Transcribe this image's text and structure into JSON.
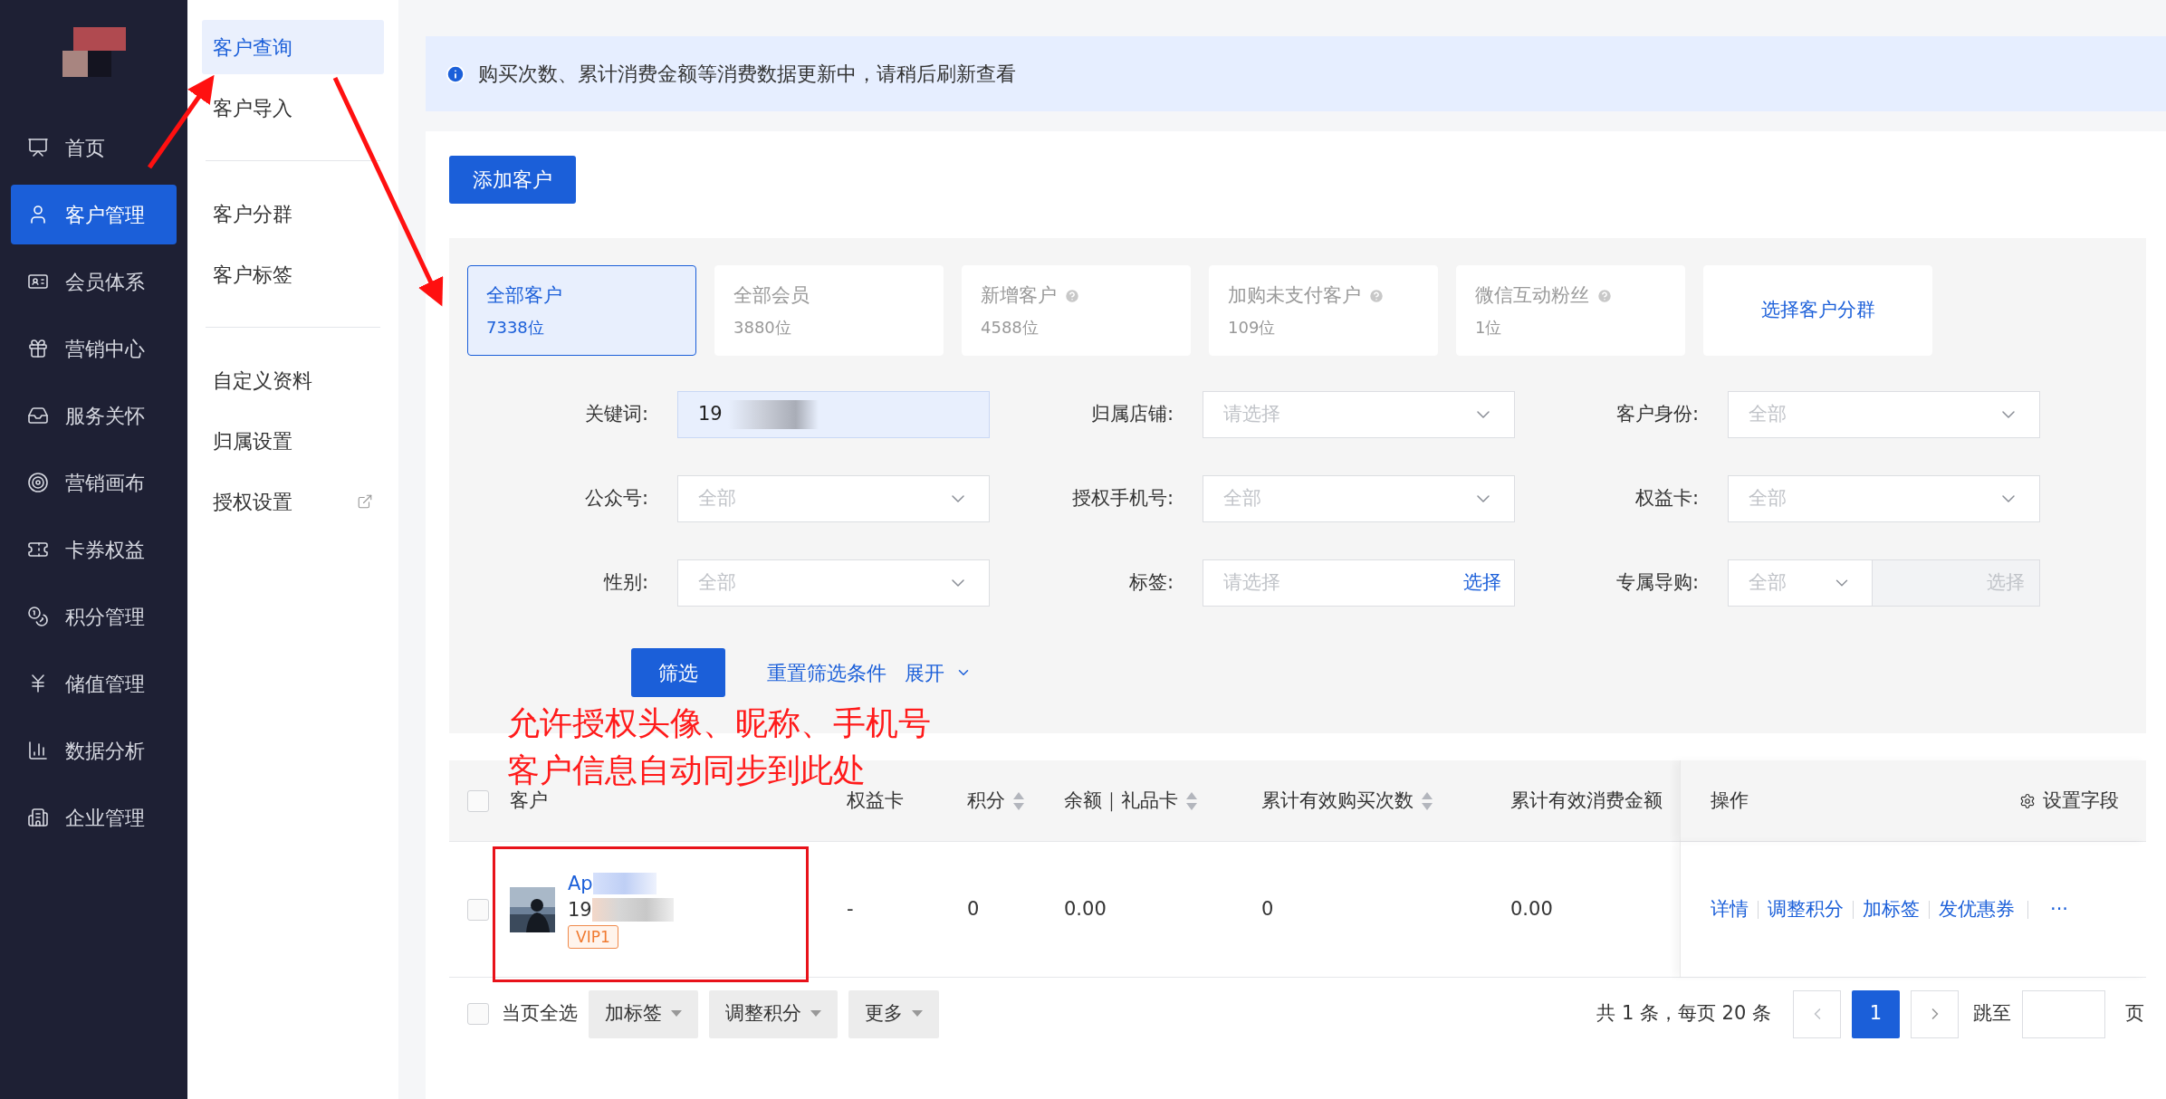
{
  "sidebar": {
    "items": [
      {
        "label": "首页",
        "selected": false
      },
      {
        "label": "客户管理",
        "selected": true
      },
      {
        "label": "会员体系",
        "selected": false
      },
      {
        "label": "营销中心",
        "selected": false
      },
      {
        "label": "服务关怀",
        "selected": false
      },
      {
        "label": "营销画布",
        "selected": false
      },
      {
        "label": "卡券权益",
        "selected": false
      },
      {
        "label": "积分管理",
        "selected": false
      },
      {
        "label": "储值管理",
        "selected": false
      },
      {
        "label": "数据分析",
        "selected": false
      },
      {
        "label": "企业管理",
        "selected": false
      }
    ]
  },
  "subnav": {
    "groups": [
      [
        {
          "label": "客户查询",
          "selected": true,
          "external": false
        },
        {
          "label": "客户导入",
          "selected": false,
          "external": false
        }
      ],
      [
        {
          "label": "客户分群",
          "selected": false,
          "external": false
        },
        {
          "label": "客户标签",
          "selected": false,
          "external": false
        }
      ],
      [
        {
          "label": "自定义资料",
          "selected": false,
          "external": false
        },
        {
          "label": "归属设置",
          "selected": false,
          "external": false
        },
        {
          "label": "授权设置",
          "selected": false,
          "external": true
        }
      ]
    ]
  },
  "notice": {
    "text": "购买次数、累计消费金额等消费数据更新中，请稍后刷新查看"
  },
  "add_button": "添加客户",
  "segments": [
    {
      "kind": "stat",
      "label": "全部客户",
      "count": "7338位",
      "help": false,
      "selected": true
    },
    {
      "kind": "stat",
      "label": "全部会员",
      "count": "3880位",
      "help": false,
      "selected": false
    },
    {
      "kind": "stat",
      "label": "新增客户",
      "count": "4588位",
      "help": true,
      "selected": false
    },
    {
      "kind": "stat",
      "label": "加购未支付客户",
      "count": "109位",
      "help": true,
      "selected": false
    },
    {
      "kind": "stat",
      "label": "微信互动粉丝",
      "count": "1位",
      "help": true,
      "selected": false
    },
    {
      "kind": "link",
      "label": "选择客户分群",
      "selected": false
    }
  ],
  "filters": [
    {
      "kind": "text",
      "label": "关键词:",
      "value": "19"
    },
    {
      "kind": "select",
      "label": "归属店铺:",
      "placeholder": "请选择"
    },
    {
      "kind": "select",
      "label": "客户身份:",
      "placeholder": "全部"
    },
    {
      "kind": "select",
      "label": "公众号:",
      "placeholder": "全部"
    },
    {
      "kind": "select",
      "label": "授权手机号:",
      "placeholder": "全部"
    },
    {
      "kind": "select",
      "label": "权益卡:",
      "placeholder": "全部"
    },
    {
      "kind": "select",
      "label": "性别:",
      "placeholder": "全部"
    },
    {
      "kind": "picker",
      "label": "标签:",
      "placeholder": "请选择",
      "action": "选择"
    },
    {
      "kind": "combo",
      "label": "专属导购:",
      "placeholder": "全部",
      "action": "选择"
    }
  ],
  "filter_actions": {
    "submit": "筛选",
    "reset": "重置筛选条件",
    "expand": "展开",
    "expanded": false
  },
  "annotation": {
    "lines": [
      "允许授权头像、昵称、手机号",
      "客户信息自动同步到此处"
    ]
  },
  "table": {
    "columns": [
      {
        "label": "客户",
        "sortable": false
      },
      {
        "label": "权益卡",
        "sortable": false
      },
      {
        "label": "积分",
        "sortable": true
      },
      {
        "label": "余额｜礼品卡",
        "sortable": true
      },
      {
        "label": "累计有效购买次数",
        "sortable": true
      },
      {
        "label": "累计有效消费金额",
        "sortable": false
      },
      {
        "label": "操作",
        "sortable": false
      }
    ],
    "settings": "设置字段",
    "header_checked": false,
    "rows": [
      {
        "checked": false,
        "name": "Ap",
        "phone": "19",
        "tag": "VIP1",
        "card": "-",
        "points": "0",
        "balance": "0.00",
        "count": "0",
        "amount": "0.00",
        "actions": [
          "详情",
          "调整积分",
          "加标签",
          "发优惠券"
        ],
        "more": "···"
      }
    ]
  },
  "footer": {
    "select_all": "当页全选",
    "checked": false,
    "bulk": [
      "加标签",
      "调整积分",
      "更多"
    ],
    "summary": "共 1 条，每页 20 条",
    "pages": [
      {
        "label": "1",
        "selected": true
      }
    ],
    "jump": "跳至",
    "page_unit": "页"
  }
}
